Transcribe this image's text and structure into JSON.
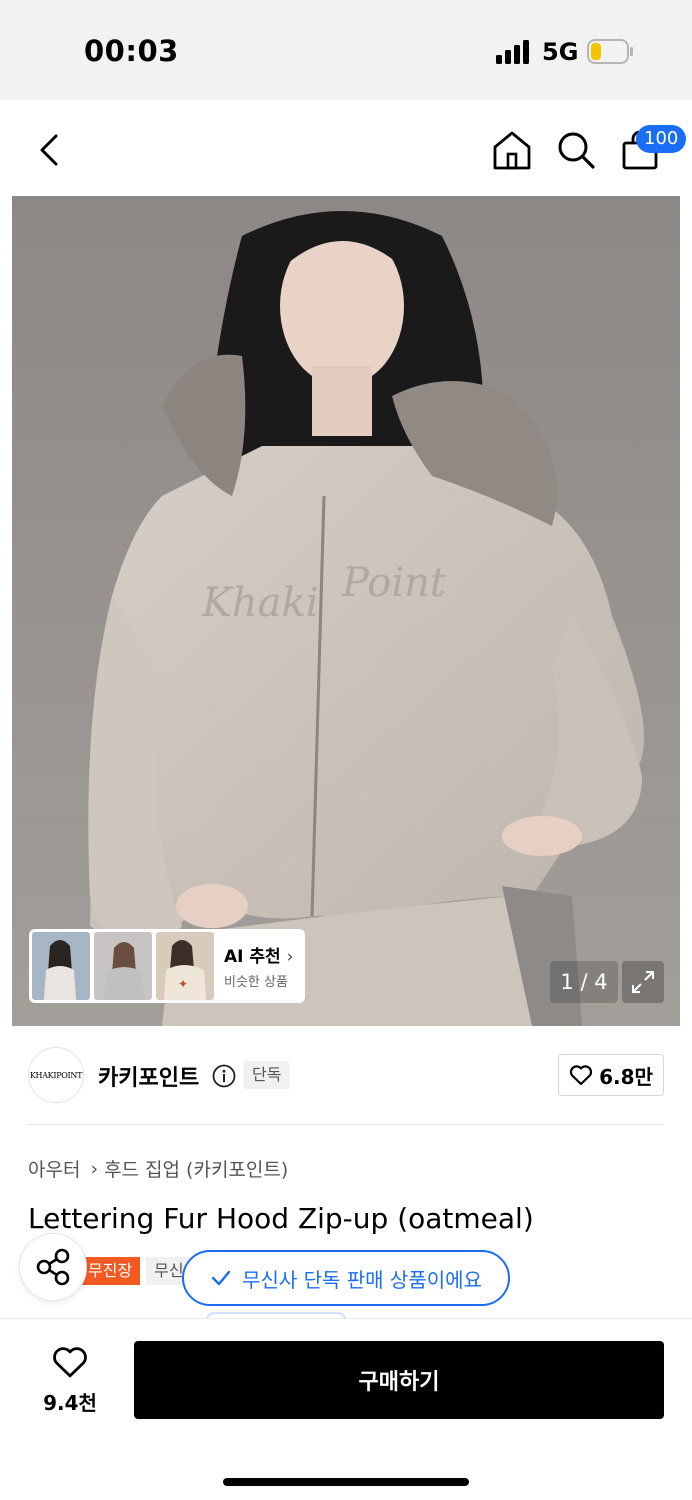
{
  "status": {
    "time": "00:03",
    "network": "5G"
  },
  "header": {
    "cart_count": "100"
  },
  "gallery": {
    "page_indicator": "1 / 4",
    "ai": {
      "title": "AI 추천",
      "subtitle": "비슷한 상품"
    }
  },
  "brand": {
    "name": "카키포인트",
    "logo_text": "KHAKIPOINT",
    "tag": "단독",
    "likes": "6.8만"
  },
  "breadcrumb": {
    "category": "아우터",
    "subcategory": "후드 집업 (카키포인트)"
  },
  "product": {
    "title": "Lettering Fur Hood Zip-up (oatmeal)",
    "tags": [
      "무진장",
      "무신"
    ]
  },
  "toast": {
    "text": "무신사 단독 판매 상품이에요"
  },
  "bottom": {
    "wish_count": "9.4천",
    "buy_label": "구매하기"
  },
  "colors": {
    "accent": "#1a6ef5",
    "sale_tag": "#f25a22",
    "buy_button": "#000000"
  },
  "icons": [
    "back-icon",
    "home-icon",
    "search-icon",
    "bag-icon",
    "info-icon",
    "heart-icon",
    "share-icon",
    "check-icon",
    "expand-icon"
  ]
}
